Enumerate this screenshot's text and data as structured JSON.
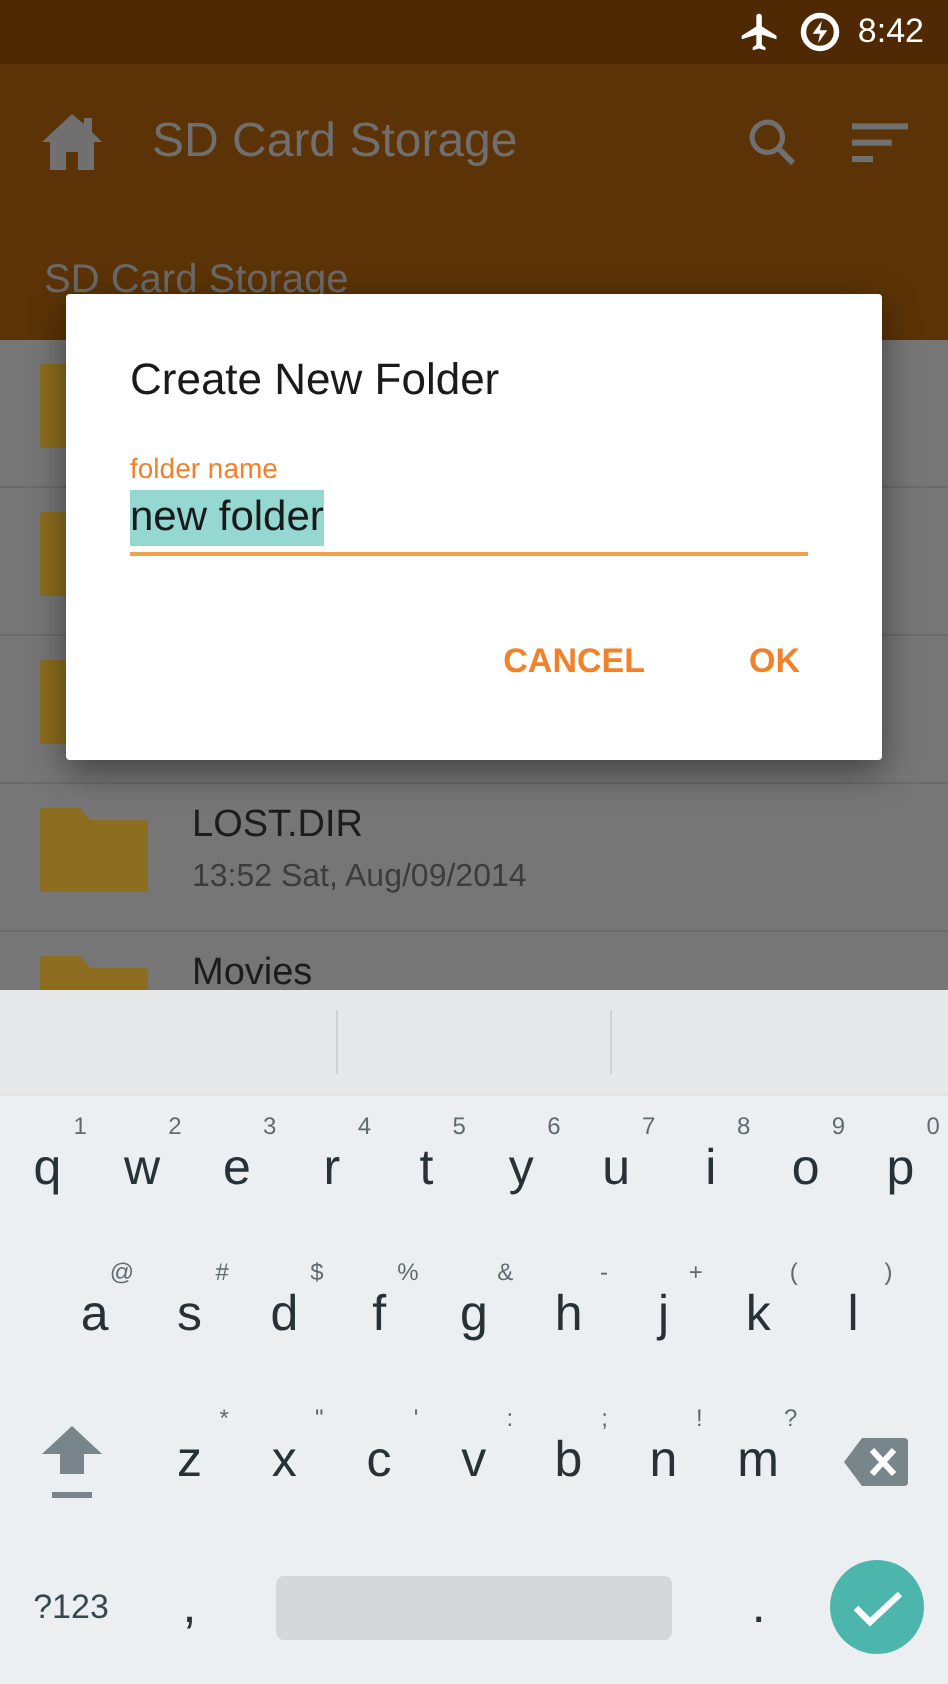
{
  "status_bar": {
    "time": "8:42"
  },
  "app_bar": {
    "title": "SD Card Storage"
  },
  "breadcrumb": "SD Card Storage",
  "folders": [
    {
      "kind": "folder"
    },
    {
      "kind": "folder"
    },
    {
      "kind": "folder"
    },
    {
      "kind": "folder",
      "name": "LOST.DIR",
      "date": "13:52 Sat, Aug/09/2014"
    },
    {
      "kind": "folder",
      "name": "Movies"
    }
  ],
  "dialog": {
    "title": "Create New Folder",
    "field": {
      "label": "folder name",
      "value": "new folder",
      "selected": true
    },
    "buttons": [
      "CANCEL",
      "OK"
    ]
  },
  "keyboard": {
    "rows": [
      [
        {
          "kind": "key",
          "key": "q",
          "hint": "1"
        },
        {
          "kind": "key",
          "key": "w",
          "hint": "2"
        },
        {
          "kind": "key",
          "key": "e",
          "hint": "3"
        },
        {
          "kind": "key",
          "key": "r",
          "hint": "4"
        },
        {
          "kind": "key",
          "key": "t",
          "hint": "5"
        },
        {
          "kind": "key",
          "key": "y",
          "hint": "6"
        },
        {
          "kind": "key",
          "key": "u",
          "hint": "7"
        },
        {
          "kind": "key",
          "key": "i",
          "hint": "8"
        },
        {
          "kind": "key",
          "key": "o",
          "hint": "9"
        },
        {
          "kind": "key",
          "key": "p",
          "hint": "0"
        }
      ],
      [
        {
          "kind": "key",
          "key": "a",
          "hint": "@"
        },
        {
          "kind": "key",
          "key": "s",
          "hint": "#"
        },
        {
          "kind": "key",
          "key": "d",
          "hint": "$"
        },
        {
          "kind": "key",
          "key": "f",
          "hint": "%"
        },
        {
          "kind": "key",
          "key": "g",
          "hint": "&"
        },
        {
          "kind": "key",
          "key": "h",
          "hint": "-"
        },
        {
          "kind": "key",
          "key": "j",
          "hint": "+"
        },
        {
          "kind": "key",
          "key": "k",
          "hint": "("
        },
        {
          "kind": "key",
          "key": "l",
          "hint": ")"
        }
      ],
      [
        {
          "kind": "shift"
        },
        {
          "kind": "key",
          "key": "z",
          "hint": "*"
        },
        {
          "kind": "key",
          "key": "x",
          "hint": "\""
        },
        {
          "kind": "key",
          "key": "c",
          "hint": "'"
        },
        {
          "kind": "key",
          "key": "v",
          "hint": ":"
        },
        {
          "kind": "key",
          "key": "b",
          "hint": ";"
        },
        {
          "kind": "key",
          "key": "n",
          "hint": "!"
        },
        {
          "kind": "key",
          "key": "m",
          "hint": "?"
        },
        {
          "kind": "backspace"
        }
      ]
    ],
    "bottom_row": [
      {
        "kind": "symbols",
        "key": "?123"
      },
      {
        "kind": "key",
        "key": ","
      },
      {
        "kind": "space"
      },
      {
        "kind": "key",
        "key": "."
      },
      {
        "kind": "enter"
      }
    ]
  }
}
